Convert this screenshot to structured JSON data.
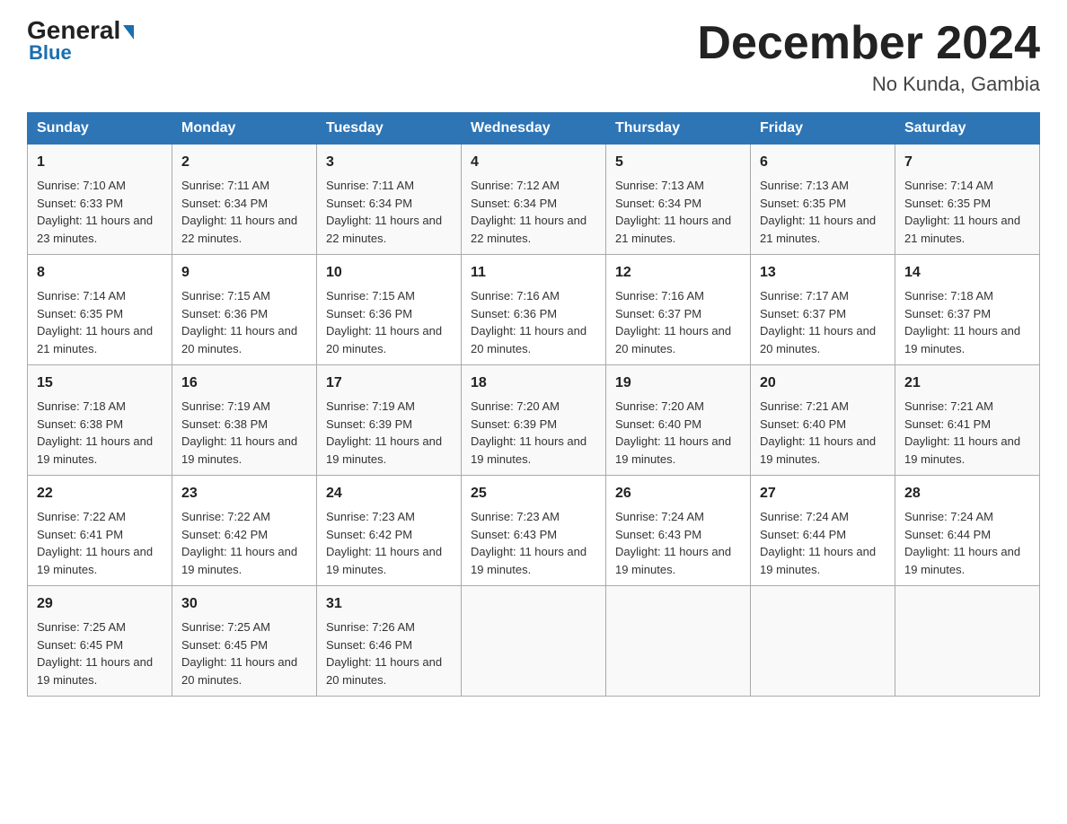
{
  "header": {
    "logo_general": "General",
    "logo_blue": "Blue",
    "title": "December 2024",
    "subtitle": "No Kunda, Gambia"
  },
  "days_of_week": [
    "Sunday",
    "Monday",
    "Tuesday",
    "Wednesday",
    "Thursday",
    "Friday",
    "Saturday"
  ],
  "weeks": [
    [
      {
        "day": "1",
        "sunrise": "7:10 AM",
        "sunset": "6:33 PM",
        "daylight": "11 hours and 23 minutes."
      },
      {
        "day": "2",
        "sunrise": "7:11 AM",
        "sunset": "6:34 PM",
        "daylight": "11 hours and 22 minutes."
      },
      {
        "day": "3",
        "sunrise": "7:11 AM",
        "sunset": "6:34 PM",
        "daylight": "11 hours and 22 minutes."
      },
      {
        "day": "4",
        "sunrise": "7:12 AM",
        "sunset": "6:34 PM",
        "daylight": "11 hours and 22 minutes."
      },
      {
        "day": "5",
        "sunrise": "7:13 AM",
        "sunset": "6:34 PM",
        "daylight": "11 hours and 21 minutes."
      },
      {
        "day": "6",
        "sunrise": "7:13 AM",
        "sunset": "6:35 PM",
        "daylight": "11 hours and 21 minutes."
      },
      {
        "day": "7",
        "sunrise": "7:14 AM",
        "sunset": "6:35 PM",
        "daylight": "11 hours and 21 minutes."
      }
    ],
    [
      {
        "day": "8",
        "sunrise": "7:14 AM",
        "sunset": "6:35 PM",
        "daylight": "11 hours and 21 minutes."
      },
      {
        "day": "9",
        "sunrise": "7:15 AM",
        "sunset": "6:36 PM",
        "daylight": "11 hours and 20 minutes."
      },
      {
        "day": "10",
        "sunrise": "7:15 AM",
        "sunset": "6:36 PM",
        "daylight": "11 hours and 20 minutes."
      },
      {
        "day": "11",
        "sunrise": "7:16 AM",
        "sunset": "6:36 PM",
        "daylight": "11 hours and 20 minutes."
      },
      {
        "day": "12",
        "sunrise": "7:16 AM",
        "sunset": "6:37 PM",
        "daylight": "11 hours and 20 minutes."
      },
      {
        "day": "13",
        "sunrise": "7:17 AM",
        "sunset": "6:37 PM",
        "daylight": "11 hours and 20 minutes."
      },
      {
        "day": "14",
        "sunrise": "7:18 AM",
        "sunset": "6:37 PM",
        "daylight": "11 hours and 19 minutes."
      }
    ],
    [
      {
        "day": "15",
        "sunrise": "7:18 AM",
        "sunset": "6:38 PM",
        "daylight": "11 hours and 19 minutes."
      },
      {
        "day": "16",
        "sunrise": "7:19 AM",
        "sunset": "6:38 PM",
        "daylight": "11 hours and 19 minutes."
      },
      {
        "day": "17",
        "sunrise": "7:19 AM",
        "sunset": "6:39 PM",
        "daylight": "11 hours and 19 minutes."
      },
      {
        "day": "18",
        "sunrise": "7:20 AM",
        "sunset": "6:39 PM",
        "daylight": "11 hours and 19 minutes."
      },
      {
        "day": "19",
        "sunrise": "7:20 AM",
        "sunset": "6:40 PM",
        "daylight": "11 hours and 19 minutes."
      },
      {
        "day": "20",
        "sunrise": "7:21 AM",
        "sunset": "6:40 PM",
        "daylight": "11 hours and 19 minutes."
      },
      {
        "day": "21",
        "sunrise": "7:21 AM",
        "sunset": "6:41 PM",
        "daylight": "11 hours and 19 minutes."
      }
    ],
    [
      {
        "day": "22",
        "sunrise": "7:22 AM",
        "sunset": "6:41 PM",
        "daylight": "11 hours and 19 minutes."
      },
      {
        "day": "23",
        "sunrise": "7:22 AM",
        "sunset": "6:42 PM",
        "daylight": "11 hours and 19 minutes."
      },
      {
        "day": "24",
        "sunrise": "7:23 AM",
        "sunset": "6:42 PM",
        "daylight": "11 hours and 19 minutes."
      },
      {
        "day": "25",
        "sunrise": "7:23 AM",
        "sunset": "6:43 PM",
        "daylight": "11 hours and 19 minutes."
      },
      {
        "day": "26",
        "sunrise": "7:24 AM",
        "sunset": "6:43 PM",
        "daylight": "11 hours and 19 minutes."
      },
      {
        "day": "27",
        "sunrise": "7:24 AM",
        "sunset": "6:44 PM",
        "daylight": "11 hours and 19 minutes."
      },
      {
        "day": "28",
        "sunrise": "7:24 AM",
        "sunset": "6:44 PM",
        "daylight": "11 hours and 19 minutes."
      }
    ],
    [
      {
        "day": "29",
        "sunrise": "7:25 AM",
        "sunset": "6:45 PM",
        "daylight": "11 hours and 19 minutes."
      },
      {
        "day": "30",
        "sunrise": "7:25 AM",
        "sunset": "6:45 PM",
        "daylight": "11 hours and 20 minutes."
      },
      {
        "day": "31",
        "sunrise": "7:26 AM",
        "sunset": "6:46 PM",
        "daylight": "11 hours and 20 minutes."
      },
      null,
      null,
      null,
      null
    ]
  ],
  "labels": {
    "sunrise": "Sunrise:",
    "sunset": "Sunset:",
    "daylight": "Daylight:"
  }
}
